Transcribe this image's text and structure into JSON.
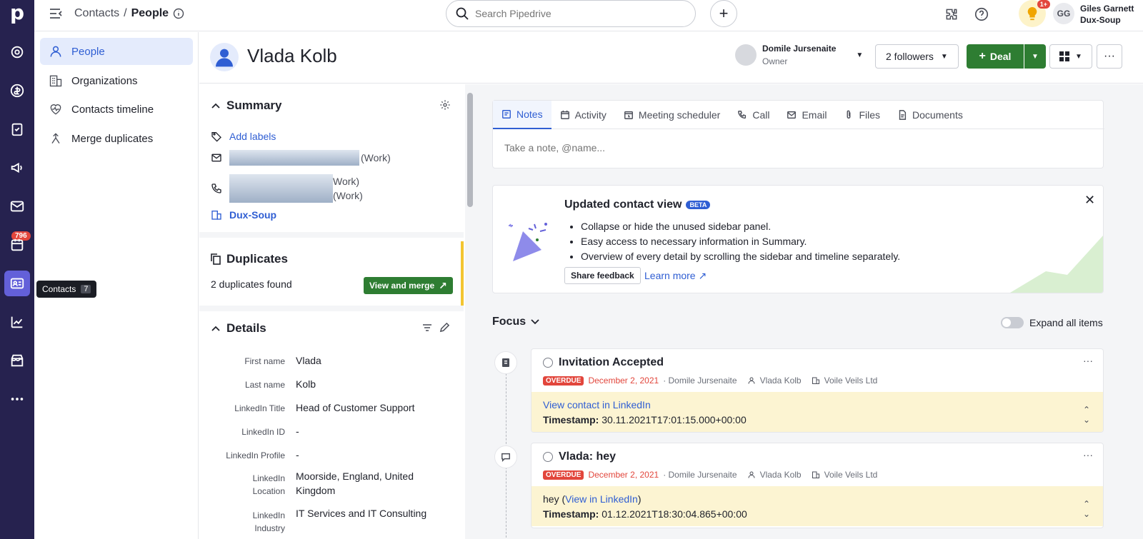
{
  "rail": {
    "logo": "p",
    "contacts_badge": "796"
  },
  "tooltip": {
    "label": "Contacts",
    "key": "7"
  },
  "breadcrumb": {
    "parent": "Contacts",
    "separator": "/",
    "current": "People"
  },
  "search": {
    "placeholder": "Search Pipedrive"
  },
  "notifications": {
    "badge": "1+"
  },
  "user": {
    "initials": "GG",
    "name": "Giles Garnett",
    "company": "Dux-Soup"
  },
  "nav": {
    "items": [
      {
        "label": "People",
        "active": true
      },
      {
        "label": "Organizations"
      },
      {
        "label": "Contacts timeline"
      },
      {
        "label": "Merge duplicates"
      }
    ]
  },
  "person": {
    "name": "Vlada Kolb"
  },
  "owner": {
    "name": "Domile Jursenaite",
    "role": "Owner"
  },
  "followers_label": "2 followers",
  "deal_label": "Deal",
  "summary": {
    "title": "Summary",
    "add_labels": "Add labels",
    "email_type": "(Work)",
    "phone_type_1": "Work)",
    "phone_type_2": "(Work)",
    "org": "Dux-Soup"
  },
  "duplicates": {
    "title": "Duplicates",
    "found": "2 duplicates found",
    "button": "View and merge"
  },
  "details": {
    "title": "Details",
    "fields": [
      {
        "label": "First name",
        "value": "Vlada"
      },
      {
        "label": "Last name",
        "value": "Kolb"
      },
      {
        "label": "LinkedIn Title",
        "value": "Head of Customer Support"
      },
      {
        "label": "LinkedIn ID",
        "value": "-"
      },
      {
        "label": "LinkedIn Profile",
        "value": "-"
      },
      {
        "label": "LinkedIn Location",
        "value": "Moorside, England, United Kingdom"
      },
      {
        "label": "LinkedIn Industry",
        "value": "IT Services and IT Consulting"
      }
    ]
  },
  "tabs": [
    "Notes",
    "Activity",
    "Meeting scheduler",
    "Call",
    "Email",
    "Files",
    "Documents"
  ],
  "note": {
    "placeholder": "Take a note, @name..."
  },
  "promo": {
    "title": "Updated contact view",
    "badge": "BETA",
    "bullets": [
      "Collapse or hide the unused sidebar panel.",
      "Easy access to necessary information in Summary.",
      "Overview of every detail by scrolling the sidebar and timeline separately."
    ],
    "share": "Share feedback",
    "learn": "Learn more ↗"
  },
  "focus": {
    "title": "Focus",
    "expand": "Expand all items"
  },
  "activities": [
    {
      "title": "Invitation Accepted",
      "status": "OVERDUE",
      "date": "December 2, 2021",
      "owner": "· Domile Jursenaite",
      "person": "Vlada Kolb",
      "org": "Voile Veils Ltd",
      "line1_link": "View contact in LinkedIn",
      "line2_label": "Timestamp:",
      "line2_value": "30.11.2021T17:01:15.000+00:00"
    },
    {
      "title": "Vlada: hey",
      "status": "OVERDUE",
      "date": "December 2, 2021",
      "owner": "· Domile Jursenaite",
      "person": "Vlada Kolb",
      "org": "Voile Veils Ltd",
      "line1_prefix": "hey (",
      "line1_link": "View in LinkedIn",
      "line1_suffix": ")",
      "line2_label": "Timestamp:",
      "line2_value": "01.12.2021T18:30:04.865+00:00"
    }
  ]
}
